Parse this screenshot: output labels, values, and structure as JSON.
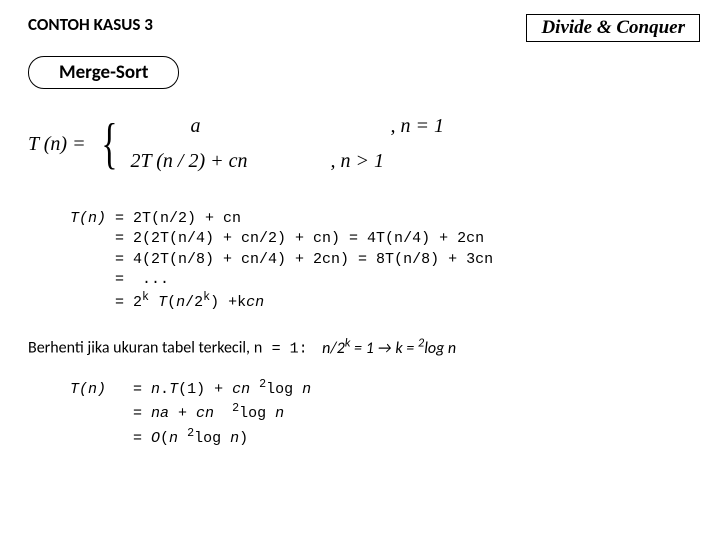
{
  "header": {
    "left": "CONTOH KASUS 3",
    "right": "Divide & Conquer"
  },
  "subtitle": "Merge-Sort",
  "piecewise": {
    "lhs": "T (n) =",
    "case1_expr": "a",
    "case1_cond": ", n = 1",
    "case2_expr": "2T (n / 2) + cn",
    "case2_cond": ", n > 1"
  },
  "recurrence": {
    "label": "T(n)",
    "lines": [
      "= 2T(n/2) + cn",
      "= 2(2T(n/4) + cn/2) + cn) = 4T(n/4) + 2cn",
      "= 4(2T(n/8) + cn/4) + 2cn) = 8T(n/8) + 3cn",
      "=  ...",
      "= 2k T(n/2k) +kcn"
    ]
  },
  "stop": {
    "text": "Berhenti jika ukuran tabel terkecil,",
    "cond": "n = 1:",
    "tail": "n/2k = 1 → k = 2log n"
  },
  "final": {
    "label": "T(n)",
    "lines": [
      "= n.T(1) + cn 2log n",
      "= na + cn  2log n",
      "= O(n 2log n)"
    ]
  }
}
